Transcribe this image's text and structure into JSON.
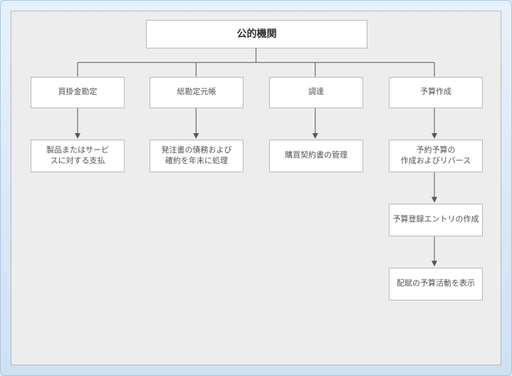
{
  "diagram": {
    "root": "公的機関",
    "branches": [
      {
        "name": "買掛金勘定",
        "steps": [
          "製品またはサービ\nスに対する支払"
        ]
      },
      {
        "name": "総勘定元帳",
        "steps": [
          "発注書の債務および\n確約を年末に処理"
        ]
      },
      {
        "name": "調達",
        "steps": [
          "購買契約書の管理"
        ]
      },
      {
        "name": "予算作成",
        "steps": [
          "予約予算の\n作成およびリバース",
          "予算登録エントリの作成",
          "配賦の予算活動を表示"
        ]
      }
    ]
  },
  "chart_data": {
    "type": "tree",
    "title": "公的機関",
    "root": "公的機関",
    "children": [
      {
        "label": "買掛金勘定",
        "children": [
          {
            "label": "製品またはサービスに対する支払"
          }
        ]
      },
      {
        "label": "総勘定元帳",
        "children": [
          {
            "label": "発注書の債務および確約を年末に処理"
          }
        ]
      },
      {
        "label": "調達",
        "children": [
          {
            "label": "購買契約書の管理"
          }
        ]
      },
      {
        "label": "予算作成",
        "children": [
          {
            "label": "予約予算の作成およびリバース",
            "children": [
              {
                "label": "予算登録エントリの作成",
                "children": [
                  {
                    "label": "配賦の予算活動を表示"
                  }
                ]
              }
            ]
          }
        ]
      }
    ]
  }
}
